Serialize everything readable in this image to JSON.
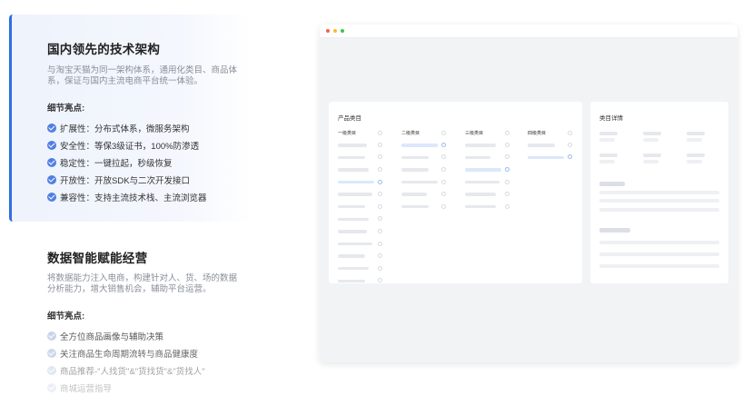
{
  "features": [
    {
      "title": "国内领先的技术架构",
      "desc": "与淘宝天猫为同一架构体系，通用化类目、商品体系，保证与国内主流电商平台统一体验。",
      "sub_title": "细节亮点:",
      "points": [
        "扩展性：分布式体系，微服务架构",
        "安全性：等保3级证书，100%防渗透",
        "稳定性：一键拉起，秒级恢复",
        "开放性：开放SDK与二次开发接口",
        "兼容性：支持主流技术栈、主流浏览器"
      ],
      "check_color": "#4f7fe3",
      "active": true
    },
    {
      "title": "数据智能赋能经营",
      "desc": "将数据能力注入电商，构建针对人、货、场的数据分析能力，增大销售机会，辅助平台运营。",
      "sub_title": "细节亮点:",
      "points": [
        "全方位商品画像与辅助决策",
        "关注商品生命周期流转与商品健康度",
        "商品推荐-\"人找货\"&\"货找货\"&\"货找人\"",
        "商城运营指导"
      ],
      "check_color": "#c9d4e8",
      "active": false
    }
  ],
  "browser_mock": {
    "window_dots": [
      "#f25f58",
      "#f8bd2d",
      "#3bc74a"
    ],
    "product_category_panel": {
      "title": "产品类目",
      "columns": [
        {
          "label": "一级类目",
          "rows": 12,
          "selected_row": 4
        },
        {
          "label": "二级类目",
          "rows": 6,
          "selected_row": 1
        },
        {
          "label": "三级类目",
          "rows": 6,
          "selected_row": 3
        },
        {
          "label": "四级类目",
          "rows": 2,
          "selected_row": 2
        }
      ]
    },
    "category_detail_panel": {
      "title": "类目详情"
    },
    "accent_color": "#2f6fe0"
  }
}
